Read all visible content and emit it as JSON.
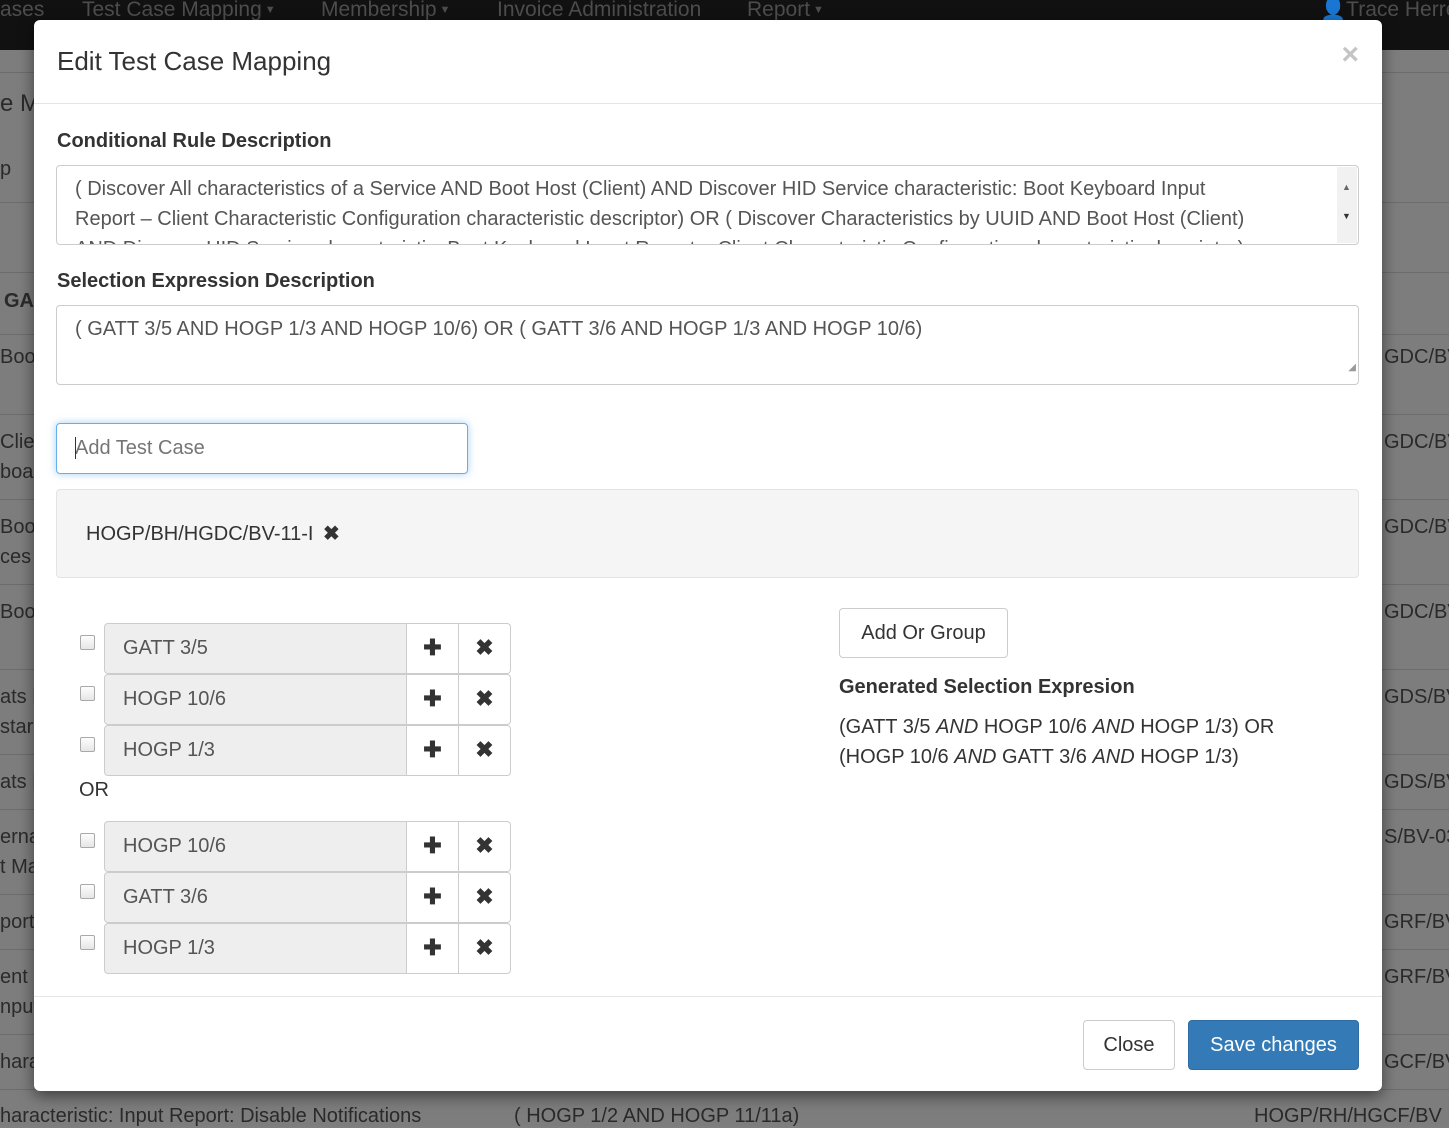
{
  "topnav": {
    "items": [
      "ases",
      "Test Case Mapping",
      "Membership",
      "Invoice Administration",
      "Report"
    ],
    "user": "Trace Herre"
  },
  "background": {
    "page_title_fragment": "e Ma",
    "left_fragments": [
      "p",
      "GA",
      "Boo",
      "Clie",
      "boar",
      "Boo",
      "ces",
      "Boo",
      "ats H",
      "star",
      "ats H",
      "erna",
      "t Ma",
      "port",
      "ent C",
      "nput",
      "hara"
    ],
    "right_fragments": [
      "GDC/BV",
      "GDC/BV",
      "GDC/BV",
      "GDC/BV",
      "GDS/BV",
      "GDS/BV",
      "S/BV-03",
      "GRF/BV",
      "GRF/BV",
      "GCF/BV"
    ],
    "bottom_row": {
      "col1": "haracteristic: Input Report: Disable Notifications",
      "col2": "( HOGP 1/2 AND HOGP 11/11a)",
      "col3": "HOGP/RH/HGCF/BV"
    }
  },
  "modal": {
    "title": "Edit Test Case Mapping",
    "close_symbol": "×",
    "conditional_rule": {
      "label": "Conditional Rule Description",
      "lines": [
        "( Discover All characteristics of a Service AND Boot Host (Client) AND Discover HID Service characteristic: Boot Keyboard Input",
        "Report – Client Characteristic Configuration characteristic descriptor) OR ( Discover Characteristics by UUID AND Boot Host (Client)",
        "AND Discover HID Service characteristic: Boot Keyboard Input Report – Client Characteristic Configuration characteristic descriptor)"
      ]
    },
    "selection_expression": {
      "label": "Selection Expression Description",
      "value": "( GATT 3/5 AND HOGP 1/3 AND HOGP 10/6) OR ( GATT 3/6 AND HOGP 1/3 AND HOGP 10/6)"
    },
    "add_test_case": {
      "placeholder": "Add Test Case",
      "value": ""
    },
    "tags": [
      {
        "label": "HOGP/BH/HGDC/BV-11-I",
        "remove_symbol": "✖"
      }
    ],
    "groups": [
      {
        "conditions": [
          {
            "label": "GATT 3/5",
            "checked": false
          },
          {
            "label": "HOGP 10/6",
            "checked": false
          },
          {
            "label": "HOGP 1/3",
            "checked": false
          }
        ]
      },
      {
        "conditions": [
          {
            "label": "HOGP 10/6",
            "checked": false
          },
          {
            "label": "GATT 3/6",
            "checked": false
          },
          {
            "label": "HOGP 1/3",
            "checked": false
          }
        ]
      }
    ],
    "or_label": "OR",
    "plus_symbol": "✚",
    "remove_symbol": "✖",
    "add_or_group_label": "Add Or Group",
    "generated": {
      "label": "Generated Selection Expresion",
      "line1": {
        "a": "(GATT 3/5 ",
        "and1": "AND",
        "b": " HOGP 10/6 ",
        "and2": "AND",
        "c": " HOGP 1/3) OR"
      },
      "line2": {
        "a": "(HOGP 10/6 ",
        "and1": "AND",
        "b": " GATT 3/6 ",
        "and2": "AND",
        "c": " HOGP 1/3)"
      }
    },
    "footer": {
      "close_label": "Close",
      "save_label": "Save changes"
    }
  },
  "colors": {
    "primary": "#337ab7",
    "overlay": "#7f7f7f",
    "navbar": "#111111"
  }
}
